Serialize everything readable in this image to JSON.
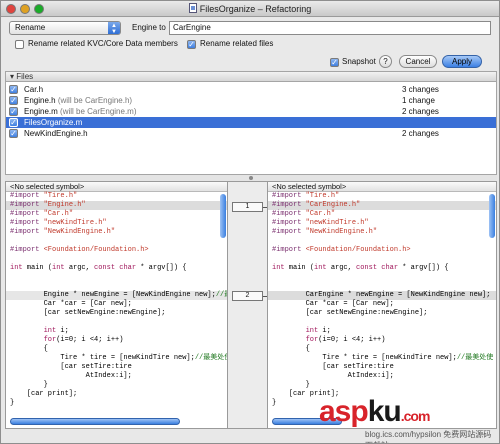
{
  "window": {
    "title": "FilesOrganize – Refactoring"
  },
  "toolbar": {
    "transformation": "Rename",
    "engine_to_label": "Engine to",
    "engine_to_value": "CarEngine",
    "rename_kvc_label": "Rename related KVC/Core Data members",
    "rename_kvc_checked": false,
    "rename_files_label": "Rename related files",
    "rename_files_checked": true,
    "snapshot_label": "Snapshot",
    "snapshot_checked": true,
    "help_label": "?",
    "cancel_label": "Cancel",
    "apply_label": "Apply"
  },
  "files": {
    "header": "Files",
    "items": [
      {
        "name": "Car.h",
        "note": "",
        "changes": "3 changes",
        "checked": true,
        "selected": false
      },
      {
        "name": "Engine.h",
        "note": "(will be CarEngine.h)",
        "changes": "1 change",
        "checked": true,
        "selected": false
      },
      {
        "name": "Engine.m",
        "note": "(will be CarEngine.m)",
        "changes": "2 changes",
        "checked": true,
        "selected": false
      },
      {
        "name": "FilesOrganize.m",
        "note": "",
        "changes": "",
        "checked": true,
        "selected": true
      },
      {
        "name": "NewKindEngine.h",
        "note": "",
        "changes": "2 changes",
        "checked": true,
        "selected": false
      }
    ]
  },
  "left_pane": {
    "symbol": "<No selected symbol>",
    "lines": [
      "#import \"Tire.h\"",
      "#import \"Engine.h\"",
      "#import \"Car.h\"",
      "#import \"newKindTire.h\"",
      "#import \"NewKindEngine.h\"",
      "",
      "#import <Foundation/Foundation.h>",
      "",
      "int main (int argc, const char * argv[]) {",
      "",
      "",
      "        Engine * newEngine = [NewKindEngine new];//最",
      "        Car *car = [Car new];",
      "        [car setNewEngine:newEngine];",
      "",
      "        int i;",
      "        for(i=0; i <4; i++)",
      "        {",
      "            Tire * tire = [newKindTire new];//最美处使",
      "            [car setTire:tire",
      "                  AtIndex:i];",
      "        }",
      "    [car print];",
      "}"
    ]
  },
  "right_pane": {
    "symbol": "<No selected symbol>",
    "lines": [
      "#import \"Tire.h\"",
      "#import \"CarEngine.h\"",
      "#import \"Car.h\"",
      "#import \"newKindTire.h\"",
      "#import \"NewKindEngine.h\"",
      "",
      "#import <Foundation/Foundation.h>",
      "",
      "int main (int argc, const char * argv[]) {",
      "",
      "",
      "        CarEngine * newEngine = [NewKindEngine new];",
      "        Car *car = [Car new];",
      "        [car setNewEngine:newEngine];",
      "",
      "        int i;",
      "        for(i=0; i <4; i++)",
      "        {",
      "            Tire * tire = [newKindTire new];//最美处使",
      "            [car setTire:tire",
      "                  AtIndex:i];",
      "        }",
      "    [car print];",
      "}"
    ]
  },
  "diff_markers": [
    "1",
    "2"
  ],
  "watermark": {
    "brand_a": "asp",
    "brand_b": "ku",
    "brand_c": ".com",
    "sub": "免费网站源码下载站",
    "footer_text": "blog.ics.com/hypsilon"
  }
}
